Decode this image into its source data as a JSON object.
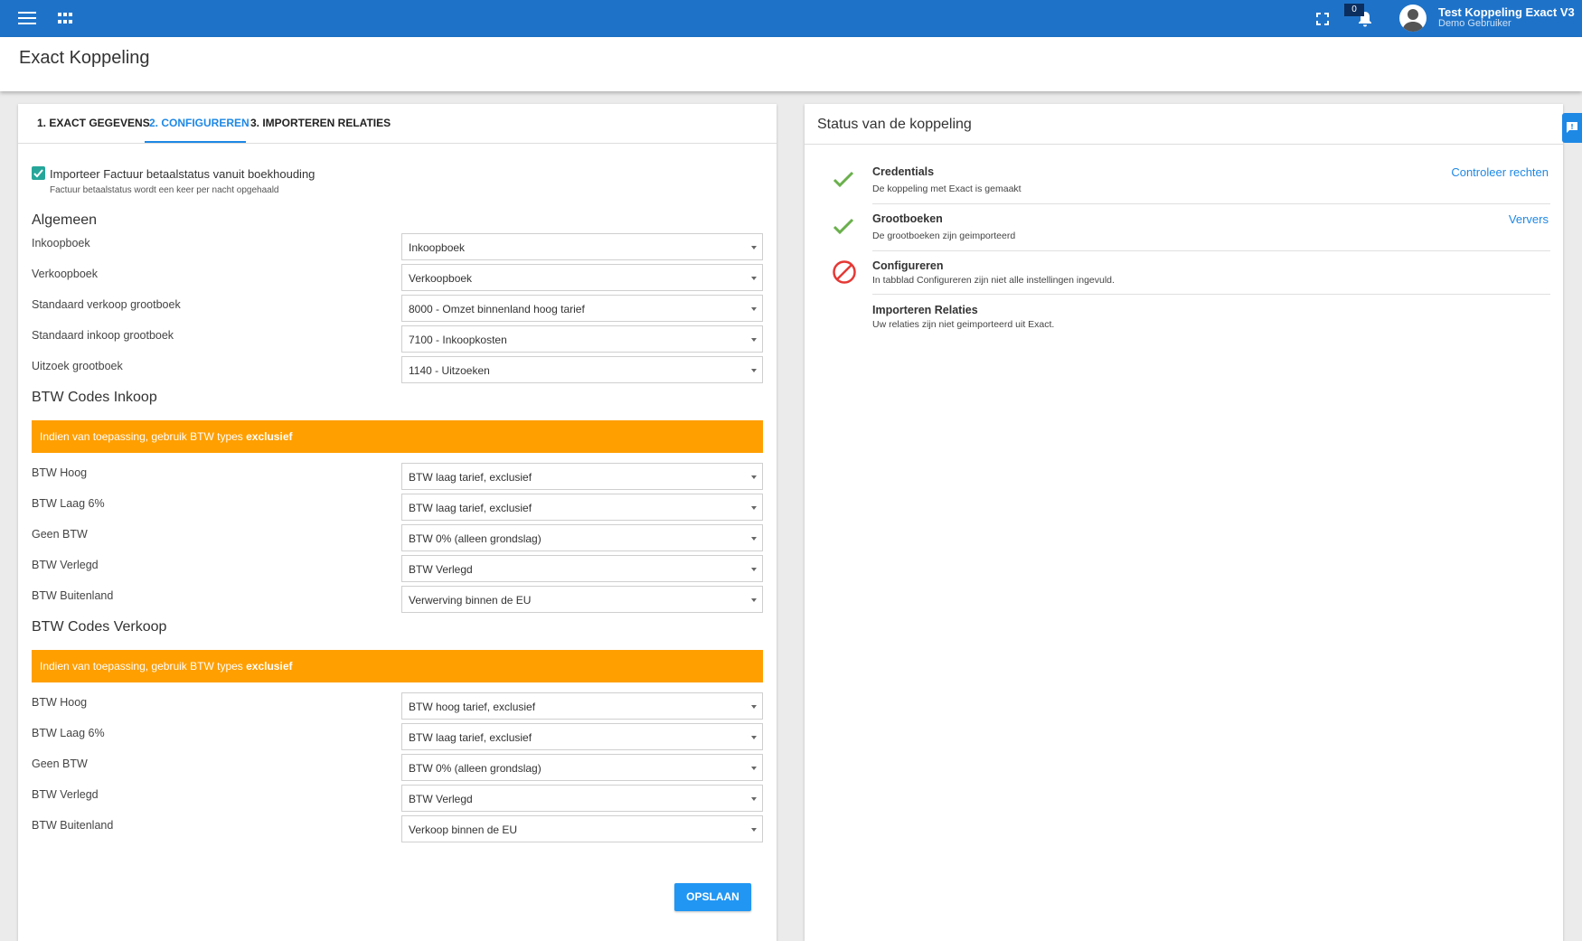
{
  "topbar": {
    "notification_count": "0",
    "user_name": "Test Koppeling Exact V3",
    "user_role": "Demo Gebruiker"
  },
  "page": {
    "title": "Exact Koppeling"
  },
  "tabs": [
    {
      "label": "1. EXACT GEGEVENS"
    },
    {
      "label": "2. CONFIGUREREN"
    },
    {
      "label": "3. IMPORTEREN RELATIES"
    }
  ],
  "checkbox": {
    "label": "Importeer Factuur betaalstatus vanuit boekhouding",
    "hint": "Factuur betaalstatus wordt een keer per nacht opgehaald"
  },
  "algemeen": {
    "title": "Algemeen",
    "fields": [
      {
        "label": "Inkoopboek",
        "value": "Inkoopboek"
      },
      {
        "label": "Verkoopboek",
        "value": "Verkoopboek"
      },
      {
        "label": "Standaard verkoop grootboek",
        "value": "8000 - Omzet binnenland hoog tarief"
      },
      {
        "label": "Standaard inkoop grootboek",
        "value": "7100 - Inkoopkosten"
      },
      {
        "label": "Uitzoek grootboek",
        "value": "1140 - Uitzoeken"
      }
    ]
  },
  "btw_inkoop": {
    "title": "BTW Codes Inkoop",
    "alert_text": "Indien van toepassing, gebruik BTW types ",
    "alert_bold": "exclusief",
    "fields": [
      {
        "label": "BTW Hoog",
        "value": "BTW laag tarief, exclusief"
      },
      {
        "label": "BTW Laag 6%",
        "value": "BTW laag tarief, exclusief"
      },
      {
        "label": "Geen BTW",
        "value": "BTW 0% (alleen grondslag)"
      },
      {
        "label": "BTW Verlegd",
        "value": "BTW Verlegd"
      },
      {
        "label": "BTW Buitenland",
        "value": "Verwerving binnen de EU"
      }
    ]
  },
  "btw_verkoop": {
    "title": "BTW Codes Verkoop",
    "alert_text": "Indien van toepassing, gebruik BTW types ",
    "alert_bold": "exclusief",
    "fields": [
      {
        "label": "BTW Hoog",
        "value": "BTW hoog tarief, exclusief"
      },
      {
        "label": "BTW Laag 6%",
        "value": "BTW laag tarief, exclusief"
      },
      {
        "label": "Geen BTW",
        "value": "BTW 0% (alleen grondslag)"
      },
      {
        "label": "BTW Verlegd",
        "value": "BTW Verlegd"
      },
      {
        "label": "BTW Buitenland",
        "value": "Verkoop binnen de EU"
      }
    ]
  },
  "save_label": "OPSLAAN",
  "status": {
    "title": "Status van de koppeling",
    "items": [
      {
        "title": "Credentials",
        "desc": "De koppeling met Exact is gemaakt",
        "link": "Controleer rechten",
        "icon": "check-icon"
      },
      {
        "title": "Grootboeken",
        "desc": "De grootboeken zijn geimporteerd",
        "link": "Ververs",
        "icon": "check-icon"
      },
      {
        "title": "Configureren",
        "desc": "In tabblad Configureren zijn niet alle instellingen ingevuld.",
        "icon": "blocked-icon"
      },
      {
        "title": "Importeren Relaties",
        "desc": "Uw relaties zijn niet geimporteerd uit Exact."
      }
    ]
  },
  "colors": {
    "primary": "#1e73c9",
    "accent": "#1e88e5",
    "warning": "#ff9f00",
    "success": "#6ab04c",
    "error": "#e53935"
  }
}
